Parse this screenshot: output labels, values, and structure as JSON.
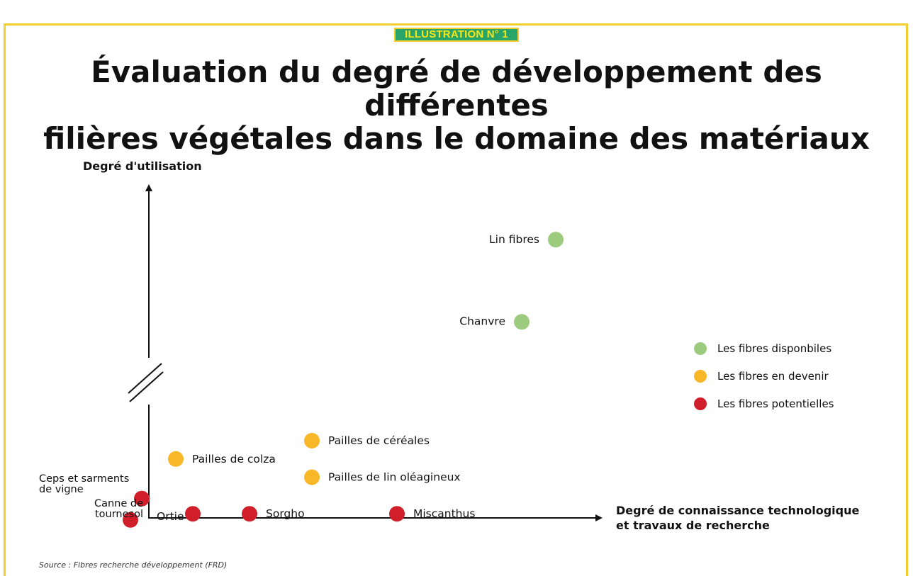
{
  "badge": "ILLUSTRATION N° 1",
  "title_lines": [
    "Évaluation du degré de développement des différentes",
    "filières végétales dans le domaine des matériaux"
  ],
  "source": "Source : Fibres recherche développement (FRD)",
  "chart_data": {
    "type": "scatter",
    "ylabel": "Degré d'utilisation",
    "xlabel_lines": [
      "Degré de connaissance technologique",
      "et travaux de recherche"
    ],
    "axis_break_on_y": true,
    "grid": false,
    "legend_placement": "right",
    "series": [
      {
        "name": "Les fibres disponbiles",
        "color": "#9ccb7e",
        "points": [
          {
            "label": "Lin fibres",
            "x": 7.8,
            "y": 9.6
          },
          {
            "label": "Chanvre",
            "x": 7.2,
            "y": 6.9
          }
        ]
      },
      {
        "name": "Les fibres en devenir",
        "color": "#f7b726",
        "points": [
          {
            "label": "Pailles de céréales",
            "x": 3.5,
            "y": 3.0
          },
          {
            "label": "Pailles de colza",
            "x": 1.1,
            "y": 2.4
          },
          {
            "label": "Pailles de lin oléagineux",
            "x": 3.5,
            "y": 1.8
          }
        ]
      },
      {
        "name": "Les fibres potentielles",
        "color": "#d01f2a",
        "points": [
          {
            "label": "Ceps et sarments\nde vigne",
            "x": 0.5,
            "y": 1.1
          },
          {
            "label": "Canne de\ntournesol",
            "x": 0.3,
            "y": 0.4
          },
          {
            "label": "Ortie",
            "x": 1.4,
            "y": 0.6
          },
          {
            "label": "Sorgho",
            "x": 2.4,
            "y": 0.6
          },
          {
            "label": "Miscanthus",
            "x": 5.0,
            "y": 0.6
          }
        ]
      }
    ]
  }
}
